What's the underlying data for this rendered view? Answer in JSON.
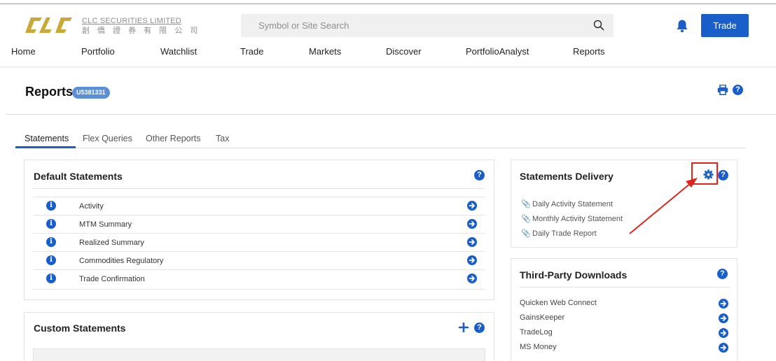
{
  "header": {
    "logo": {
      "mark": "CLC",
      "company_en": "CLC SECURITIES LIMITED",
      "company_cn": "創 僑 證 券 有 限 公 司"
    },
    "search": {
      "placeholder": "Symbol or Site Search",
      "icon": "search-icon"
    },
    "notification_icon": "bell-icon",
    "trade_button": "Trade"
  },
  "nav": {
    "items": [
      "Home",
      "Portfolio",
      "Watchlist",
      "Trade",
      "Markets",
      "Discover",
      "PortfolioAnalyst",
      "Reports"
    ]
  },
  "page": {
    "title": "Reports",
    "account_id": "U5381331",
    "print_icon": "print-icon",
    "help_icon": "help-icon"
  },
  "tabs": {
    "items": [
      "Statements",
      "Flex Queries",
      "Other Reports",
      "Tax"
    ],
    "active": "Statements"
  },
  "default_statements": {
    "title": "Default Statements",
    "rows": [
      "Activity",
      "MTM Summary",
      "Realized Summary",
      "Commodities Regulatory",
      "Trade Confirmation"
    ]
  },
  "custom_statements": {
    "title": "Custom Statements",
    "add_icon": "plus-icon"
  },
  "statements_delivery": {
    "title": "Statements Delivery",
    "settings_icon": "gear-icon",
    "items": [
      "Daily Activity Statement",
      "Monthly Activity Statement",
      "Daily Trade Report"
    ]
  },
  "third_party_downloads": {
    "title": "Third-Party Downloads",
    "items": [
      "Quicken Web Connect",
      "GainsKeeper",
      "TradeLog",
      "MS Money"
    ]
  },
  "colors": {
    "brand_blue": "#1a5fc9",
    "badge_blue": "#5b8fd6",
    "logo_gold": "#c9a93a",
    "annotation_red": "#e0231b"
  }
}
